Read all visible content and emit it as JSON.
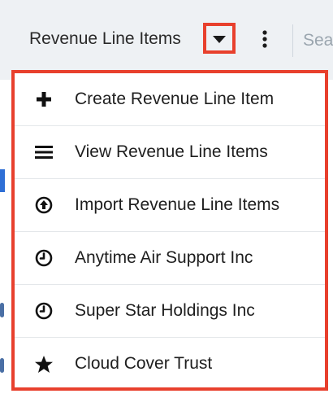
{
  "header": {
    "module_tab_label": "Revenue Line Items",
    "search_placeholder": "Sea",
    "dropdown_toggle_icon": "caret-down-icon",
    "more_actions_icon": "kebab-vertical-icon"
  },
  "menu": {
    "items": [
      {
        "label": "Create Revenue Line Item",
        "icon": "plus-icon"
      },
      {
        "label": "View Revenue Line Items",
        "icon": "list-icon"
      },
      {
        "label": "Import Revenue Line Items",
        "icon": "import-icon"
      },
      {
        "label": "Anytime Air Support Inc",
        "icon": "clock-icon"
      },
      {
        "label": "Super Star Holdings Inc",
        "icon": "clock-icon"
      },
      {
        "label": "Cloud Cover Trust",
        "icon": "star-icon"
      }
    ]
  },
  "colors": {
    "highlight": "#e8402d",
    "topbar_bg": "#eef1f4",
    "text": "#1e1e1e"
  }
}
